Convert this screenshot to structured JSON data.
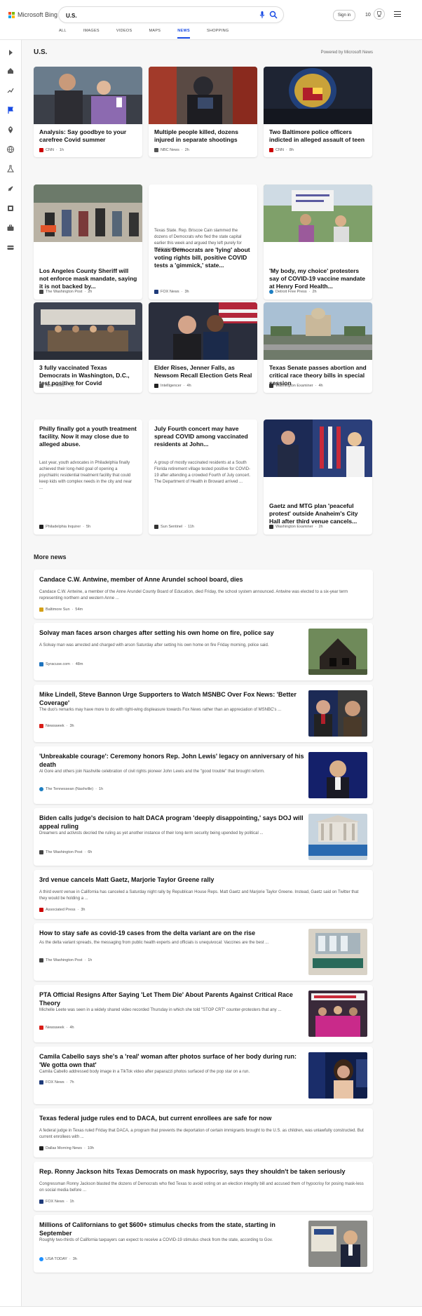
{
  "header": {
    "logo_text": "Microsoft Bing",
    "search_value": "U.S.",
    "signin_label": "Sign in",
    "rewards_count": "10"
  },
  "tabs": [
    {
      "label": "ALL"
    },
    {
      "label": "IMAGES"
    },
    {
      "label": "VIDEOS"
    },
    {
      "label": "MAPS"
    },
    {
      "label": "NEWS"
    },
    {
      "label": "SHOPPING"
    }
  ],
  "main": {
    "title": "U.S.",
    "powered_by": "Powered by Microsoft News"
  },
  "cards": [
    {
      "title": "Analysis: Say goodbye to your carefree Covid summer",
      "source": "CNN",
      "age": "1h",
      "src_color": "#cc0000"
    },
    {
      "title": "Multiple people killed, dozens injured in separate shootings",
      "source": "NBC News",
      "age": "2h",
      "src_color": "#555555"
    },
    {
      "title": "Two Baltimore police officers indicted in alleged assault of teen",
      "source": "CNN",
      "age": "8h",
      "src_color": "#cc0000"
    },
    {
      "title": "Los Angeles County Sheriff will not enforce mask mandate, saying it is not backed by...",
      "source": "The Washington Post",
      "age": "2h",
      "src_color": "#444444"
    },
    {
      "title": "Texas Democrats are 'lying' about voting rights bill, positive COVID tests a 'gimmick,' state...",
      "desc": "Texas State. Rep. Briscoe Cain slammed the dozens of Democrats who fled the state capital earlier this week and argued they left purely for political reasons.",
      "source": "FOX News",
      "age": "3h",
      "src_color": "#1f3b7a"
    },
    {
      "title": "'My body, my choice' protesters say of COVID-19 vaccine mandate at Henry Ford Health...",
      "source": "Detroit Free Press",
      "age": "2h",
      "src_color": "#1e7fc2"
    },
    {
      "title": "3 fully vaccinated Texas Democrats in Washington, D.C., test positive for Covid",
      "source": "NBC News",
      "age": "2h",
      "src_color": "#555555"
    },
    {
      "title": "Elder Rises, Jenner Falls, as Newsom Recall Election Gets Real",
      "source": "Intelligencer",
      "age": "4h",
      "src_color": "#222222"
    },
    {
      "title": "Texas Senate passes abortion and critical race theory bills in special session",
      "source": "Washington Examiner",
      "age": "4h",
      "src_color": "#333333"
    },
    {
      "title": "Philly finally got a youth treatment facility. Now it may close due to alleged abuse.",
      "desc": "Last year, youth advocates in Philadelphia finally achieved their long-held goal of opening a psychiatric residential treatment facility that could keep kids with complex needs in the city and near ...",
      "source": "Philadelphia Inquirer",
      "age": "5h",
      "src_color": "#222222"
    },
    {
      "title": "July Fourth concert may have spread COVID among vaccinated residents at John...",
      "desc": "A group of mostly vaccinated residents at a South Florida retirement village tested positive for COVID-19 after attending a crowded Fourth of July concert. The Department of Health in Broward arrived ...",
      "source": "Sun Sentinel",
      "age": "11h",
      "src_color": "#333333"
    },
    {
      "title": "Gaetz and MTG plan 'peaceful protest' outside Anaheim's City Hall after third venue cancels...",
      "source": "Washington Examiner",
      "age": "2h",
      "src_color": "#333333"
    }
  ],
  "more_news": {
    "title": "More news",
    "items": [
      {
        "title": "Candace C.W. Antwine, member of Anne Arundel school board, dies",
        "desc": "Candace C.W. Antwine, a member of the Anne Arundel County Board of Education, died Friday, the school system announced. Antwine was elected to a six-year term representing northern and western Anne ...",
        "source": "Baltimore Sun",
        "age": "54m",
        "src_color": "#d4a017"
      },
      {
        "title": "Solvay man faces arson charges after setting his own home on fire, police say",
        "desc": "A Solvay man was arrested and charged with arson Saturday after setting his own home on fire Friday morning, police said.",
        "source": "Syracuse.com",
        "age": "48m",
        "src_color": "#1e73be"
      },
      {
        "title": "Mike Lindell, Steve Bannon Urge Supporters to Watch MSNBC Over Fox News: 'Better Coverage'",
        "desc": "The duo's remarks may have more to do with right-wing displeasure towards Fox News rather than an appreciation of MSNBC's ...",
        "source": "Newsweek",
        "age": "3h",
        "src_color": "#d91e18"
      },
      {
        "title": "'Unbreakable courage': Ceremony honors Rep. John Lewis' legacy on anniversary of his death",
        "desc": "Al Gore and others join Nashville celebration of civil rights pioneer John Lewis and the \"good trouble\" that brought reform.",
        "source": "The Tennessean (Nashville)",
        "age": "1h",
        "src_color": "#1e7fc2"
      },
      {
        "title": "Biden calls judge's decision to halt DACA program 'deeply disappointing,' says DOJ will appeal ruling",
        "desc": "Dreamers and activists decried the ruling as yet another instance of their long-term security being upended by political ...",
        "source": "The Washington Post",
        "age": "6h",
        "src_color": "#444444"
      },
      {
        "title": "3rd venue cancels Matt Gaetz, Marjorie Taylor Greene rally",
        "desc": "A third event venue in California has canceled a Saturday night rally by Republican House Reps. Matt Gaetz and Marjorie Taylor Greene. Instead, Gaetz said on Twitter that they would be holding a ...",
        "source": "Associated Press",
        "age": "3h",
        "src_color": "#cc0000"
      },
      {
        "title": "How to stay safe as covid-19 cases from the delta variant are on the rise",
        "desc": "As the delta variant spreads, the messaging from public health experts and officials is unequivocal: Vaccines are the best ...",
        "source": "The Washington Post",
        "age": "1h",
        "src_color": "#444444"
      },
      {
        "title": "PTA Official Resigns After Saying 'Let Them Die' About Parents Against Critical Race Theory",
        "desc": "Michelle Leete was seen in a widely shared video recorded Thursday in which she told \"STOP CRT\" counter-protesters that any ...",
        "source": "Newsweek",
        "age": "4h",
        "src_color": "#d91e18"
      },
      {
        "title": "Camila Cabello says she's a 'real' woman after photos surface of her body during run: 'We gotta own that'",
        "desc": "Camila Cabello addressed body image in a TikTok video after paparazzi photos surfaced of the pop star on a run.",
        "source": "FOX News",
        "age": "7h",
        "src_color": "#1f3b7a"
      },
      {
        "title": "Texas federal judge rules end to DACA, but current enrollees are safe for now",
        "desc": "A federal judge in Texas ruled Friday that DACA, a program that prevents the deportation of certain immigrants brought to the U.S. as children, was unlawfully constructed. But current enrollees with ...",
        "source": "Dallas Morning News",
        "age": "10h",
        "src_color": "#222222"
      },
      {
        "title": "Rep. Ronny Jackson hits Texas Democrats on mask hypocrisy, says they shouldn't be taken seriously",
        "desc": "Congressman Ronny Jackson blasted the dozens of Democrats who fled Texas to avoid voting on an election integrity bill and accused them of hypocrisy for posing mask-less on social media before ...",
        "source": "FOX News",
        "age": "1h",
        "src_color": "#1f3b7a"
      },
      {
        "title": "Millions of Californians to get $600+ stimulus checks from the state, starting in September",
        "desc": "Roughly two-thirds of California taxpayers can expect to receive a COVID-19 stimulus check from the state, according to Gov.",
        "source": "USA TODAY",
        "age": "3h",
        "src_color": "#1e90ff"
      }
    ]
  },
  "colors": {
    "accent": "#174ae4",
    "text": "#111111",
    "muted": "#555555"
  }
}
